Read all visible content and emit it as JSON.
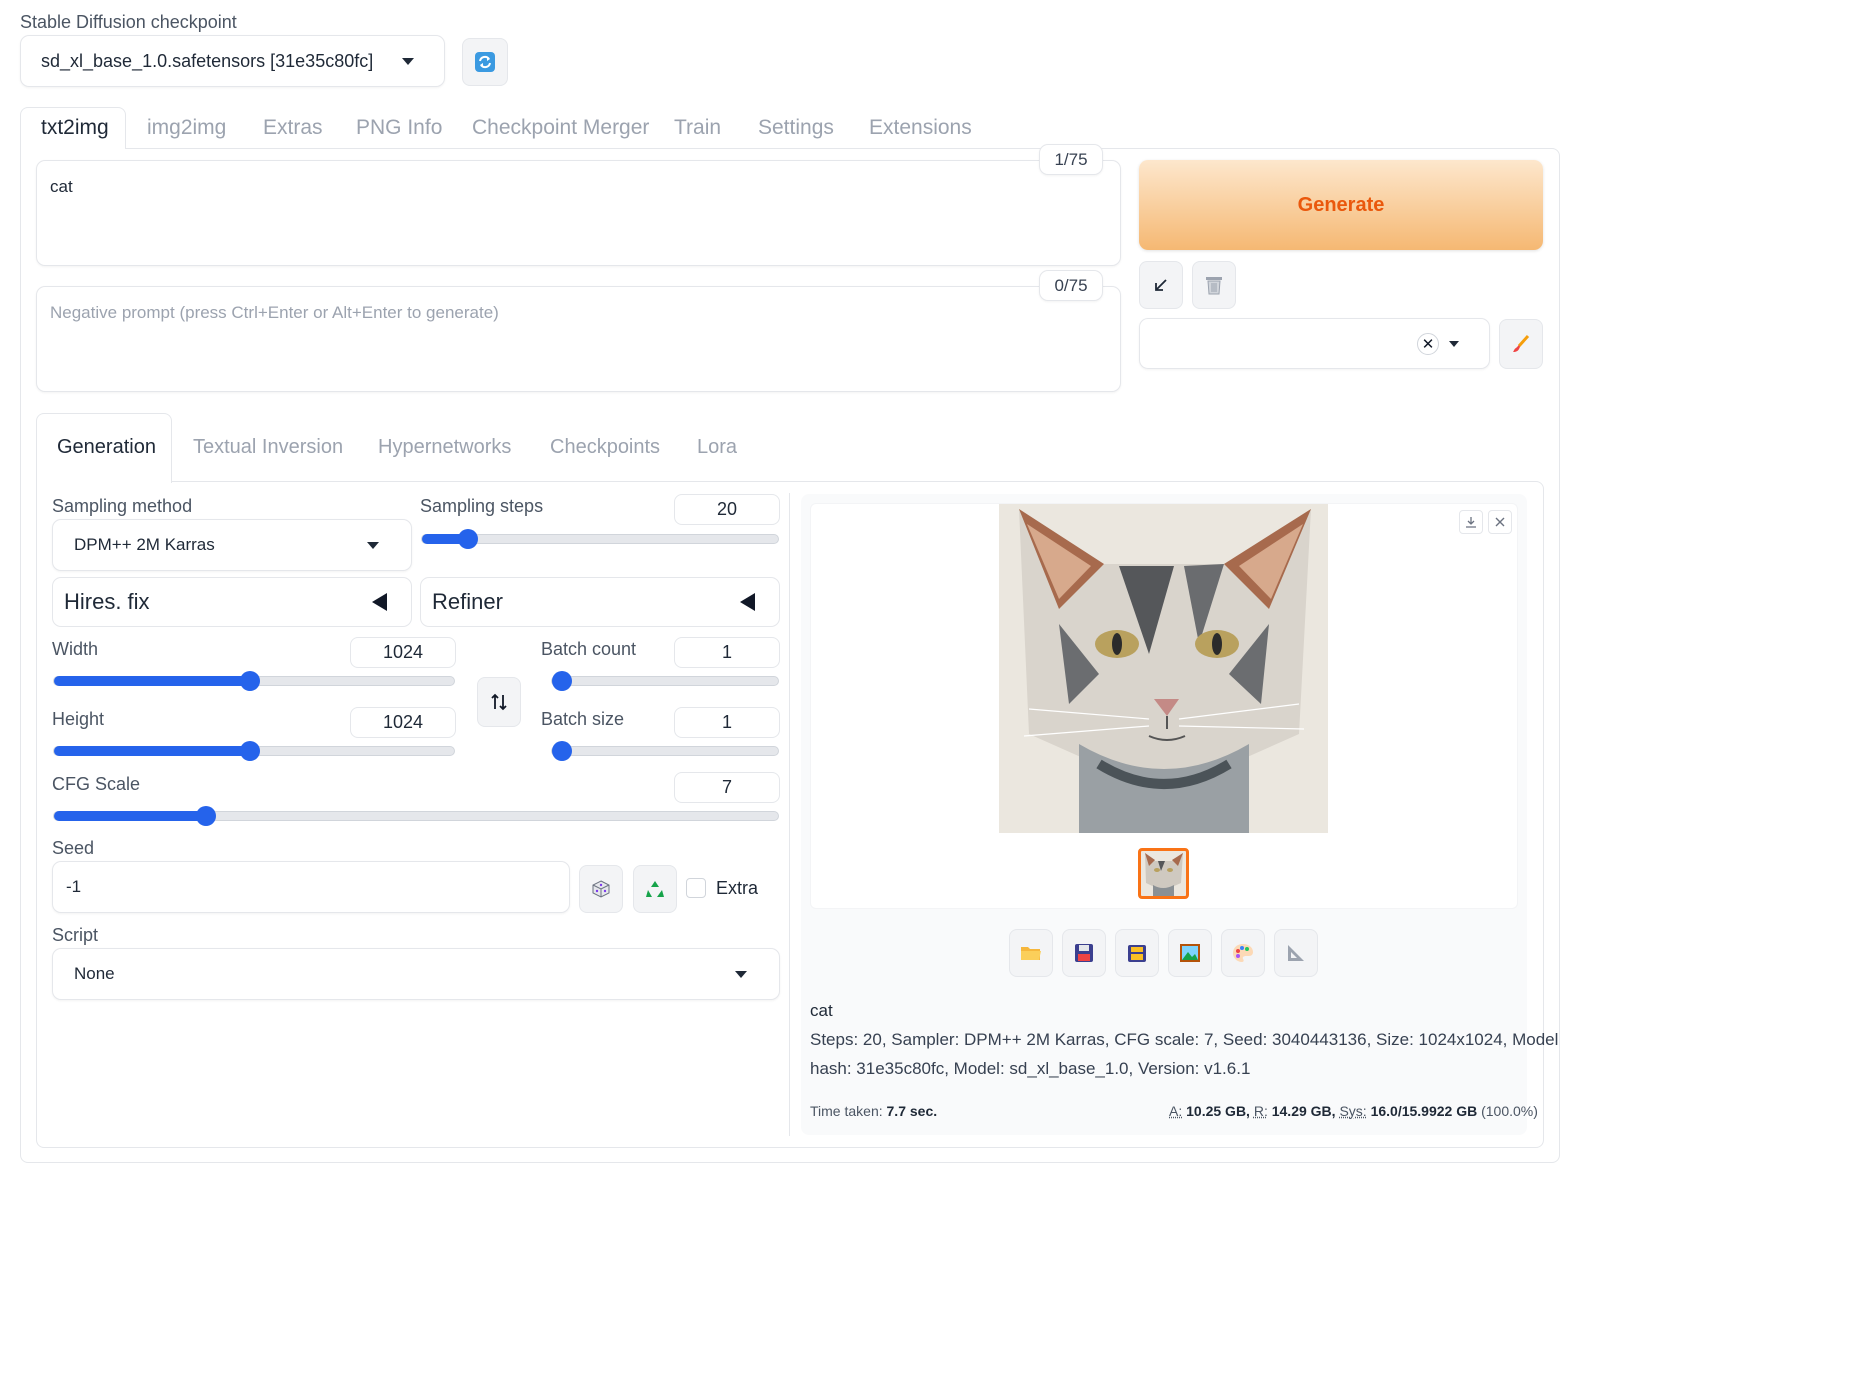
{
  "checkpoint": {
    "label": "Stable Diffusion checkpoint",
    "value": "sd_xl_base_1.0.safetensors [31e35c80fc]"
  },
  "main_tabs": [
    "txt2img",
    "img2img",
    "Extras",
    "PNG Info",
    "Checkpoint Merger",
    "Train",
    "Settings",
    "Extensions"
  ],
  "prompt": {
    "value": "cat",
    "token_count": "1/75"
  },
  "negative_prompt": {
    "placeholder": "Negative prompt (press Ctrl+Enter or Alt+Enter to generate)",
    "token_count": "0/75"
  },
  "generate_label": "Generate",
  "sub_tabs": [
    "Generation",
    "Textual Inversion",
    "Hypernetworks",
    "Checkpoints",
    "Lora"
  ],
  "sampling_method": {
    "label": "Sampling method",
    "value": "DPM++ 2M Karras"
  },
  "sampling_steps": {
    "label": "Sampling steps",
    "value": "20",
    "fraction": 0.13
  },
  "hires_fix_label": "Hires. fix",
  "refiner_label": "Refiner",
  "width": {
    "label": "Width",
    "value": "1024",
    "fraction": 0.49
  },
  "height": {
    "label": "Height",
    "value": "1024",
    "fraction": 0.49
  },
  "batch_count": {
    "label": "Batch count",
    "value": "1",
    "fraction": 0.0
  },
  "batch_size": {
    "label": "Batch size",
    "value": "1",
    "fraction": 0.0
  },
  "cfg_scale": {
    "label": "CFG Scale",
    "value": "7",
    "fraction": 0.21
  },
  "seed": {
    "label": "Seed",
    "value": "-1",
    "extra_label": "Extra"
  },
  "script": {
    "label": "Script",
    "value": "None"
  },
  "output": {
    "prompt_text": "cat",
    "params_line1": "Steps: 20, Sampler: DPM++ 2M Karras, CFG scale: 7, Seed: 3040443136, Size: 1024x1024, Model",
    "params_line2": "hash: 31e35c80fc, Model: sd_xl_base_1.0, Version: v1.6.1",
    "time_label": "Time taken:",
    "time_value": "7.7 sec.",
    "mem_a_label": "A:",
    "mem_a_value": "10.25 GB,",
    "mem_r_label": "R:",
    "mem_r_value": "14.29 GB,",
    "mem_sys_label": "Sys:",
    "mem_sys_value": "16.0/15.9922 GB",
    "mem_pct": "(100.0%)"
  },
  "colors": {
    "accent": "#2563eb",
    "generate_text": "#ea580c",
    "generate_bg_from": "#fde7cd",
    "generate_bg_to": "#f5b873"
  }
}
